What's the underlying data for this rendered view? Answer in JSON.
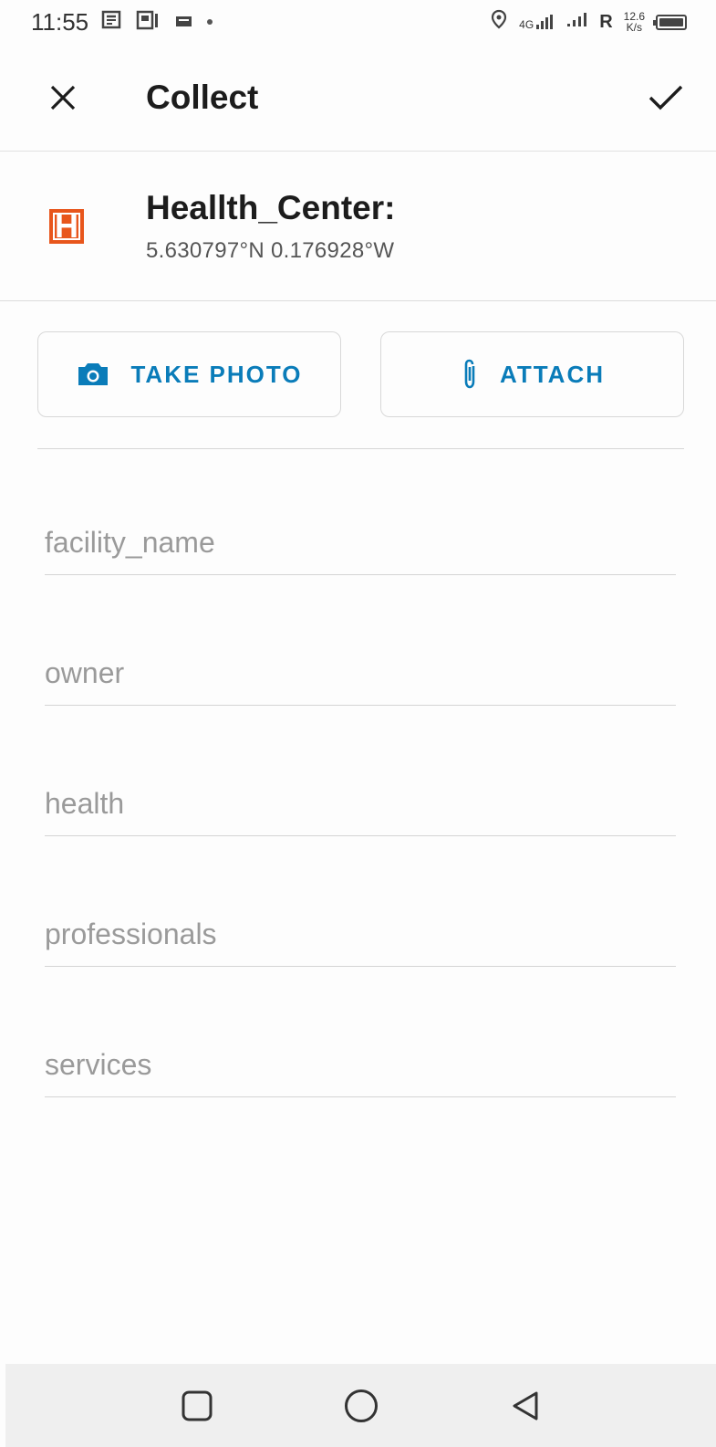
{
  "status_bar": {
    "time": "11:55",
    "network_type": "4G",
    "roaming": "R",
    "speed_value": "12.6",
    "speed_unit": "K/s"
  },
  "app_bar": {
    "title": "Collect"
  },
  "feature": {
    "name": "Heallth_Center:",
    "coordinates": "5.630797°N  0.176928°W",
    "symbol_letter": "H",
    "symbol_color": "#e8561c"
  },
  "actions": {
    "take_photo_label": "TAKE PHOTO",
    "attach_label": "ATTACH",
    "accent_color": "#0a7cb9"
  },
  "form": {
    "fields": [
      {
        "placeholder": "facility_name",
        "value": ""
      },
      {
        "placeholder": "owner",
        "value": ""
      },
      {
        "placeholder": "health",
        "value": ""
      },
      {
        "placeholder": "professionals",
        "value": ""
      },
      {
        "placeholder": "services",
        "value": ""
      }
    ]
  },
  "icons": {
    "close": "close-icon",
    "confirm": "checkmark-icon",
    "camera": "camera-icon",
    "attach": "paperclip-icon",
    "nav_recents": "recents-square-icon",
    "nav_home": "home-circle-icon",
    "nav_back": "back-triangle-icon"
  }
}
